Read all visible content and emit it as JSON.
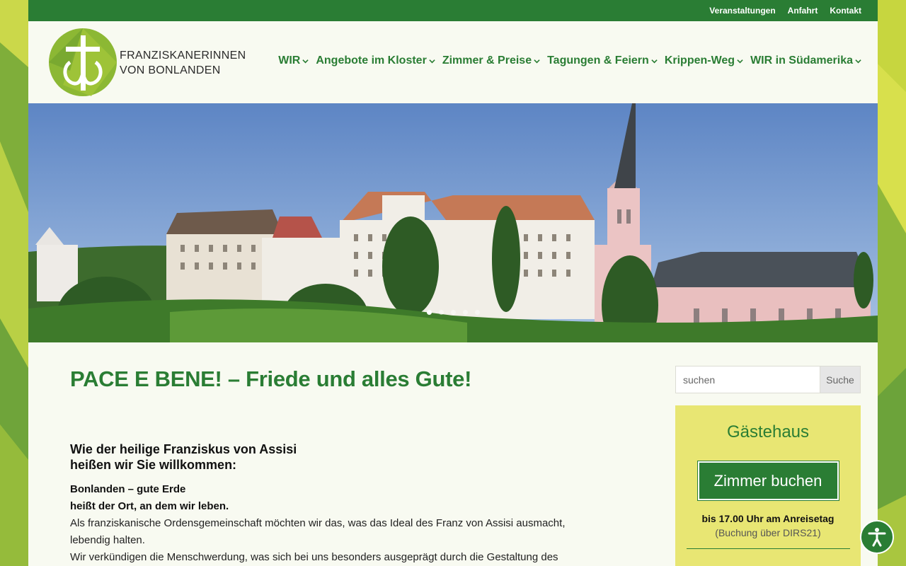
{
  "colors": {
    "brand_green": "#2a7d34",
    "guest_box": "#e8e673",
    "background": "#f8faf1"
  },
  "topbar": {
    "links": [
      "Veranstaltungen",
      "Anfahrt",
      "Kontakt"
    ]
  },
  "logo": {
    "icon": "franciscan-tau-icon",
    "line1": "FRANZISKANERINNEN",
    "line2": "VON BONLANDEN"
  },
  "nav": {
    "items": [
      {
        "label": "WIR"
      },
      {
        "label": "Angebote im Kloster"
      },
      {
        "label": "Zimmer & Preise"
      },
      {
        "label": "Tagungen & Feiern"
      },
      {
        "label": "Krippen-Weg"
      },
      {
        "label": "WIR in Südamerika"
      }
    ],
    "chevron_icon": "chevron-down-icon"
  },
  "hero": {
    "slides_total": 5,
    "active_slide": 1
  },
  "main": {
    "title": "PACE E BENE! – Friede und alles Gute!",
    "intro_line1": "Wie der heilige Franziskus von Assisi",
    "intro_line2": "heißen wir Sie willkommen:",
    "bold_line1": "Bonlanden – gute Erde",
    "bold_line2": "heißt der Ort, an dem wir leben.",
    "para1": "Als franziskanische Ordensgemeinschaft möchten wir das, was das Ideal des Franz von Assisi ausmacht, lebendig halten.",
    "para2": "Wir verkündigen die Menschwerdung, was sich bei uns besonders ausgeprägt durch die Gestaltung des"
  },
  "sidebar": {
    "search_placeholder": "suchen",
    "search_button": "Suche",
    "guest_title": "Gästehaus",
    "book_button": "Zimmer buchen",
    "deadline": "bis 17.00 Uhr am Anreisetag",
    "booking_note": "(Buchung über DIRS21)"
  },
  "accessibility": {
    "icon": "accessibility-icon"
  }
}
